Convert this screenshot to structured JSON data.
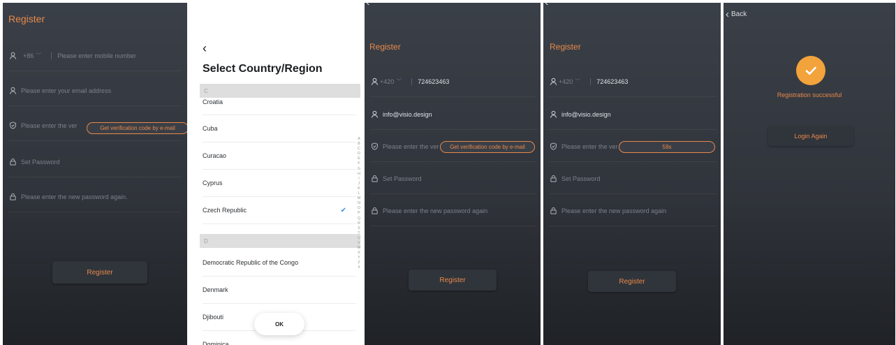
{
  "screen1": {
    "title": "Register",
    "phone": {
      "code": "+86",
      "placeholder": "Please enter mobile number"
    },
    "email_placeholder": "Please enter your email address",
    "verify_placeholder": "Please enter the ver",
    "verify_button": "Get verification code by e-mail",
    "password_placeholder": "Set Password",
    "password_again_placeholder": "Please enter the new password again.",
    "register_button": "Register"
  },
  "screen2": {
    "title": "Select Country/Region",
    "sections": [
      {
        "letter": "C",
        "items": [
          "Croatia",
          "Cuba",
          "Curacao",
          "Cyprus",
          "Czech Republic"
        ]
      },
      {
        "letter": "D",
        "items": [
          "Democratic Republic of the Congo",
          "Denmark",
          "Djibouti",
          "Dominica"
        ]
      }
    ],
    "selected": "Czech Republic",
    "alphabet": [
      "A",
      "B",
      "C",
      "D",
      "E",
      "F",
      "G",
      "H",
      "I",
      "J",
      "K",
      "L",
      "M",
      "N",
      "O",
      "P",
      "Q",
      "R",
      "S",
      "T",
      "U",
      "V",
      "W",
      "X",
      "Y",
      "Z",
      "#"
    ],
    "ok_button": "OK"
  },
  "screen3": {
    "title": "Register",
    "phone": {
      "code": "+420",
      "value": "724623463"
    },
    "email": "info@visio.design",
    "verify_placeholder": "Please enter the ver",
    "verify_button": "Get verification code by e-mail",
    "password_placeholder": "Set Password",
    "password_again_placeholder": "Please enter the new password again",
    "register_button": "Register"
  },
  "screen4": {
    "title": "Register",
    "phone": {
      "code": "+420",
      "value": "724623463"
    },
    "email": "info@visio.design",
    "verify_placeholder": "Please enter the ver",
    "countdown": "59s",
    "password_placeholder": "Set Password",
    "password_again_placeholder": "Please enter the new password again",
    "register_button": "Register"
  },
  "screen5": {
    "back_label": "Back",
    "message": "Registration successful",
    "login_button": "Login Again"
  },
  "colors": {
    "accent": "#e8894a",
    "success": "#f3a33b",
    "panel_dark": "#3b4048",
    "check": "#3a8fe4"
  },
  "icons": [
    "user-icon",
    "shield-icon",
    "lock-icon",
    "chevron-left-icon",
    "checkmark-icon"
  ]
}
